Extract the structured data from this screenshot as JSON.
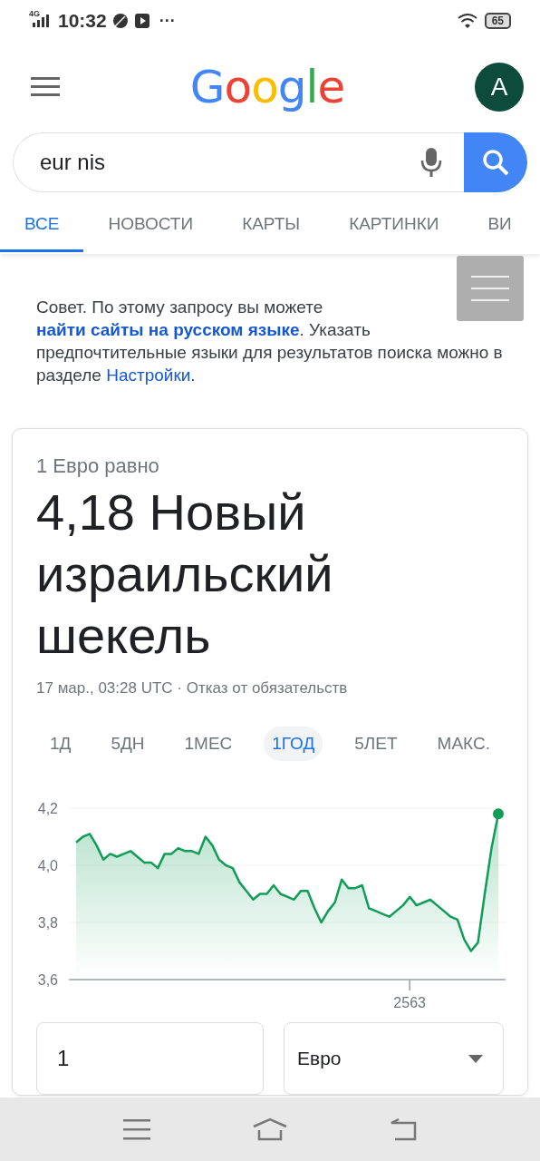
{
  "status_bar": {
    "network": "4G",
    "time": "10:32",
    "more": "···",
    "battery": "65"
  },
  "header": {
    "logo": "Google",
    "avatar": "A"
  },
  "search": {
    "value": "eur nis"
  },
  "tabs": [
    {
      "label": "ВСЕ",
      "selected": true
    },
    {
      "label": "НОВОСТИ",
      "selected": false
    },
    {
      "label": "КАРТЫ",
      "selected": false
    },
    {
      "label": "КАРТИНКИ",
      "selected": false
    },
    {
      "label": "ВИ",
      "selected": false
    }
  ],
  "tip": [
    {
      "kind": "text",
      "text": "Совет. По этому запросу вы можете "
    },
    {
      "kind": "link",
      "text": "найти сайты на русском языке"
    },
    {
      "kind": "text",
      "text": ". Указать предпочтительные языки для результатов поиска можно в разделе "
    },
    {
      "kind": "link",
      "text": "Настройки"
    },
    {
      "kind": "text",
      "text": "."
    }
  ],
  "currency": {
    "caption": "1 Евро равно",
    "result": "4,18 Новый израильский шекель",
    "timestamp": "17 мар., 03:28 UTC · Отказ от обязательств",
    "ranges": [
      {
        "label": "1Д",
        "selected": false
      },
      {
        "label": "5ДН",
        "selected": false
      },
      {
        "label": "1МЕС",
        "selected": false
      },
      {
        "label": "1ГОД",
        "selected": true
      },
      {
        "label": "5ЛЕТ",
        "selected": false
      },
      {
        "label": "МАКС.",
        "selected": false
      }
    ],
    "chart_data": {
      "type": "area",
      "ylim": [
        3.6,
        4.2
      ],
      "yticks": [
        {
          "value": 3.6,
          "label": "3,6"
        },
        {
          "value": 3.8,
          "label": "3,8"
        },
        {
          "value": 4.0,
          "label": "4,0"
        },
        {
          "value": 4.2,
          "label": "4,2"
        }
      ],
      "annotations": [
        {
          "text": "2563"
        }
      ],
      "series": [
        {
          "color": "#0f9d58",
          "values": [
            4.08,
            4.1,
            4.11,
            4.07,
            4.02,
            4.04,
            4.03,
            4.04,
            4.05,
            4.03,
            4.01,
            4.01,
            3.99,
            4.04,
            4.04,
            4.06,
            4.05,
            4.05,
            4.04,
            4.1,
            4.07,
            4.02,
            4.0,
            3.99,
            3.94,
            3.91,
            3.88,
            3.9,
            3.9,
            3.93,
            3.9,
            3.89,
            3.88,
            3.91,
            3.91,
            3.85,
            3.8,
            3.84,
            3.87,
            3.95,
            3.92,
            3.92,
            3.93,
            3.85,
            3.84,
            3.83,
            3.82,
            3.84,
            3.86,
            3.89,
            3.86,
            3.87,
            3.88,
            3.86,
            3.84,
            3.82,
            3.81,
            3.74,
            3.7,
            3.73,
            3.9,
            4.06,
            4.18
          ]
        }
      ]
    },
    "amount": "1",
    "unit": "Евро"
  }
}
